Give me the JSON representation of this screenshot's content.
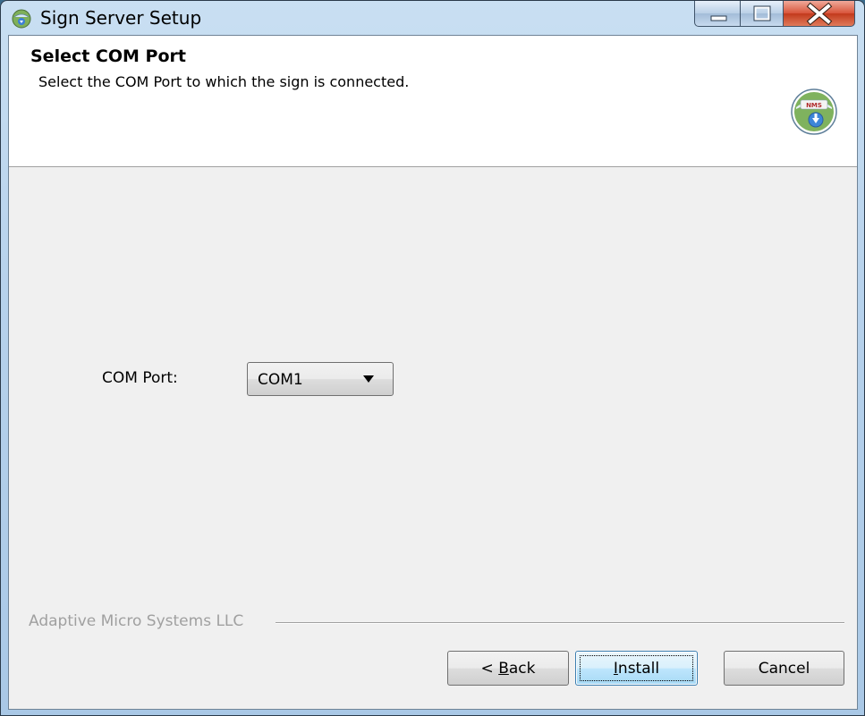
{
  "window": {
    "title": "Sign Server Setup",
    "icon": "setup-globe-icon",
    "caption_buttons": [
      "minimize",
      "maximize",
      "close"
    ]
  },
  "header": {
    "title": "Select COM Port",
    "subtitle": "Select the COM Port to which the sign is connected.",
    "logo_text": "NMS"
  },
  "form": {
    "com_port_label": "COM Port:",
    "com_port_value": "COM1"
  },
  "footer": {
    "brand": "Adaptive Micro Systems LLC",
    "buttons": {
      "back_prefix": "< ",
      "back_mnemonic": "B",
      "back_rest": "ack",
      "install_mnemonic": "I",
      "install_rest": "nstall",
      "cancel": "Cancel"
    }
  },
  "colors": {
    "title_gradient_top": "#c9dff2",
    "close_red": "#c23a1c",
    "client_bg": "#f0f0f0",
    "banner_bg": "#ffffff",
    "install_focus_border": "#3c7fb1"
  }
}
